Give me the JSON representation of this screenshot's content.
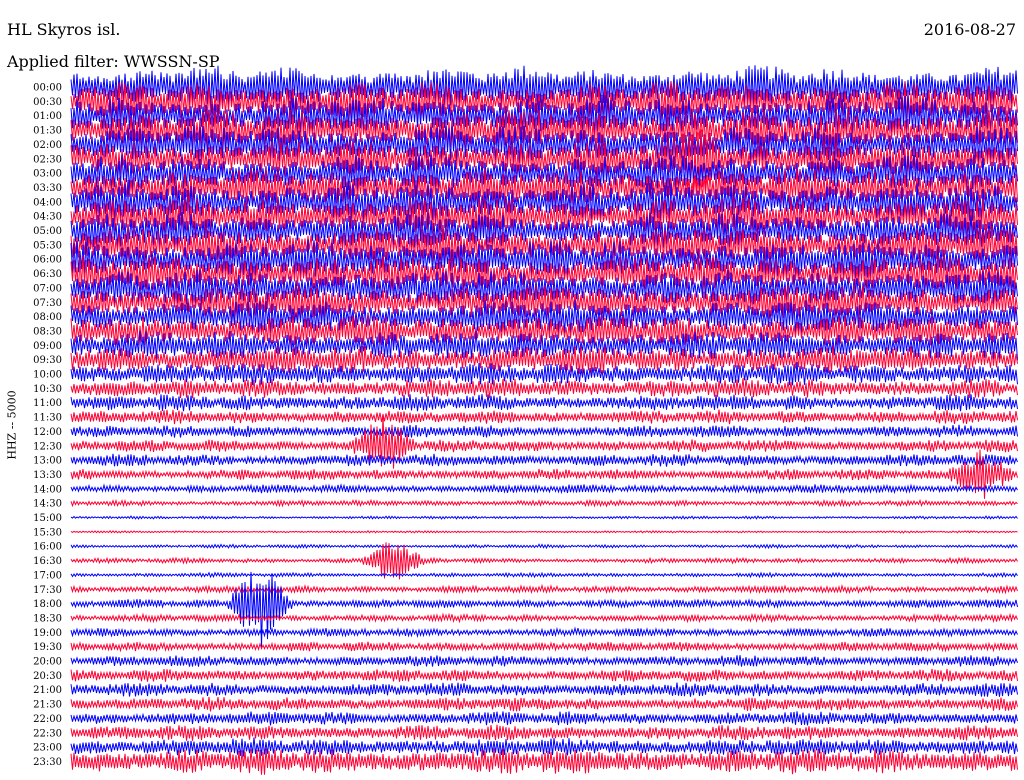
{
  "header": {
    "station": "HL Skyros isl.",
    "date": "2016-08-27",
    "filter": "Applied filter: WWSSN-SP"
  },
  "chart_data": {
    "type": "line",
    "title": "HL Skyros isl.",
    "date": "2016-08-27",
    "filter": "Applied filter: WWSSN-SP",
    "ylabel": "HHZ -- 5000",
    "row_labels": [
      "00:00",
      "00:30",
      "01:00",
      "01:30",
      "02:00",
      "02:30",
      "03:00",
      "03:30",
      "04:00",
      "04:30",
      "05:00",
      "05:30",
      "06:00",
      "06:30",
      "07:00",
      "07:30",
      "08:00",
      "08:30",
      "09:00",
      "09:30",
      "10:00",
      "10:30",
      "11:00",
      "11:30",
      "12:00",
      "12:30",
      "13:00",
      "13:30",
      "14:00",
      "14:30",
      "15:00",
      "15:30",
      "16:00",
      "16:30",
      "17:00",
      "17:30",
      "18:00",
      "18:30",
      "19:00",
      "19:30",
      "20:00",
      "20:30",
      "21:00",
      "21:30",
      "22:00",
      "22:30",
      "23:00",
      "23:30"
    ],
    "series_colors": [
      "#0000ff",
      "#ff0033"
    ],
    "noise_amplitude": [
      3.0,
      2.8,
      2.8,
      2.9,
      2.7,
      2.6,
      2.6,
      2.7,
      2.8,
      2.7,
      2.6,
      2.6,
      2.7,
      2.6,
      2.6,
      2.5,
      2.4,
      2.3,
      2.1,
      2.0,
      1.6,
      1.4,
      1.2,
      1.0,
      0.9,
      0.9,
      0.9,
      0.8,
      0.6,
      0.4,
      0.2,
      0.15,
      0.25,
      0.35,
      0.3,
      0.5,
      0.6,
      0.5,
      0.6,
      0.7,
      0.8,
      0.9,
      1.0,
      1.0,
      1.0,
      1.1,
      1.3,
      1.9
    ],
    "events": [
      {
        "row": "02:30",
        "position": 0.66,
        "strength": 1.5
      },
      {
        "row": "12:30",
        "position": 0.33,
        "strength": 1.6
      },
      {
        "row": "13:30",
        "position": 0.96,
        "strength": 1.5
      },
      {
        "row": "16:30",
        "position": 0.34,
        "strength": 1.4
      },
      {
        "row": "18:00",
        "position": 0.2,
        "strength": 2.6
      }
    ]
  }
}
